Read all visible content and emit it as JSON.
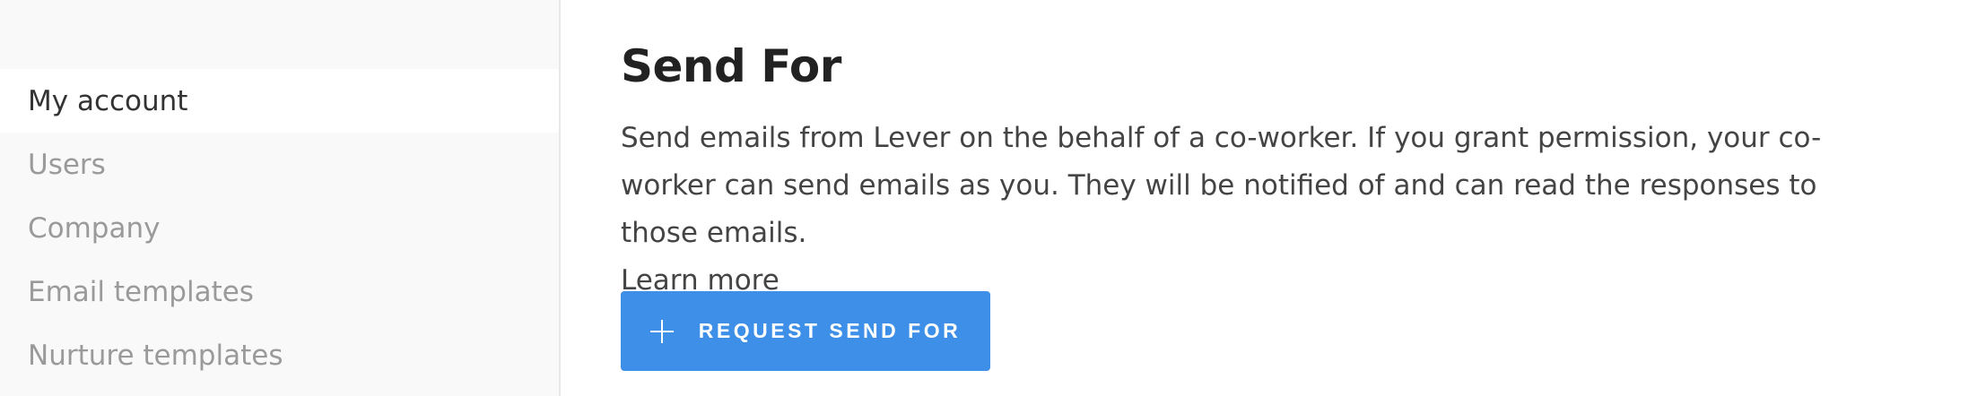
{
  "sidebar": {
    "items": [
      {
        "label": "My account",
        "active": true
      },
      {
        "label": "Users",
        "active": false
      },
      {
        "label": "Company",
        "active": false
      },
      {
        "label": "Email templates",
        "active": false
      },
      {
        "label": "Nurture templates",
        "active": false
      }
    ]
  },
  "main": {
    "title": "Send For",
    "description": "Send emails from Lever on the behalf of a co-worker. If you grant permission, your co-worker can send emails as you. They will be notified of and can read the responses to those emails.",
    "learn_more": "Learn more",
    "request_button": {
      "icon": "plus-icon",
      "label": "REQUEST SEND FOR"
    }
  },
  "colors": {
    "accent": "#3d8fe8",
    "sidebar_bg": "#f9f9f9",
    "active_item_bg": "#ffffff",
    "inactive_text": "#9a9a9a",
    "primary_text": "#333333"
  }
}
